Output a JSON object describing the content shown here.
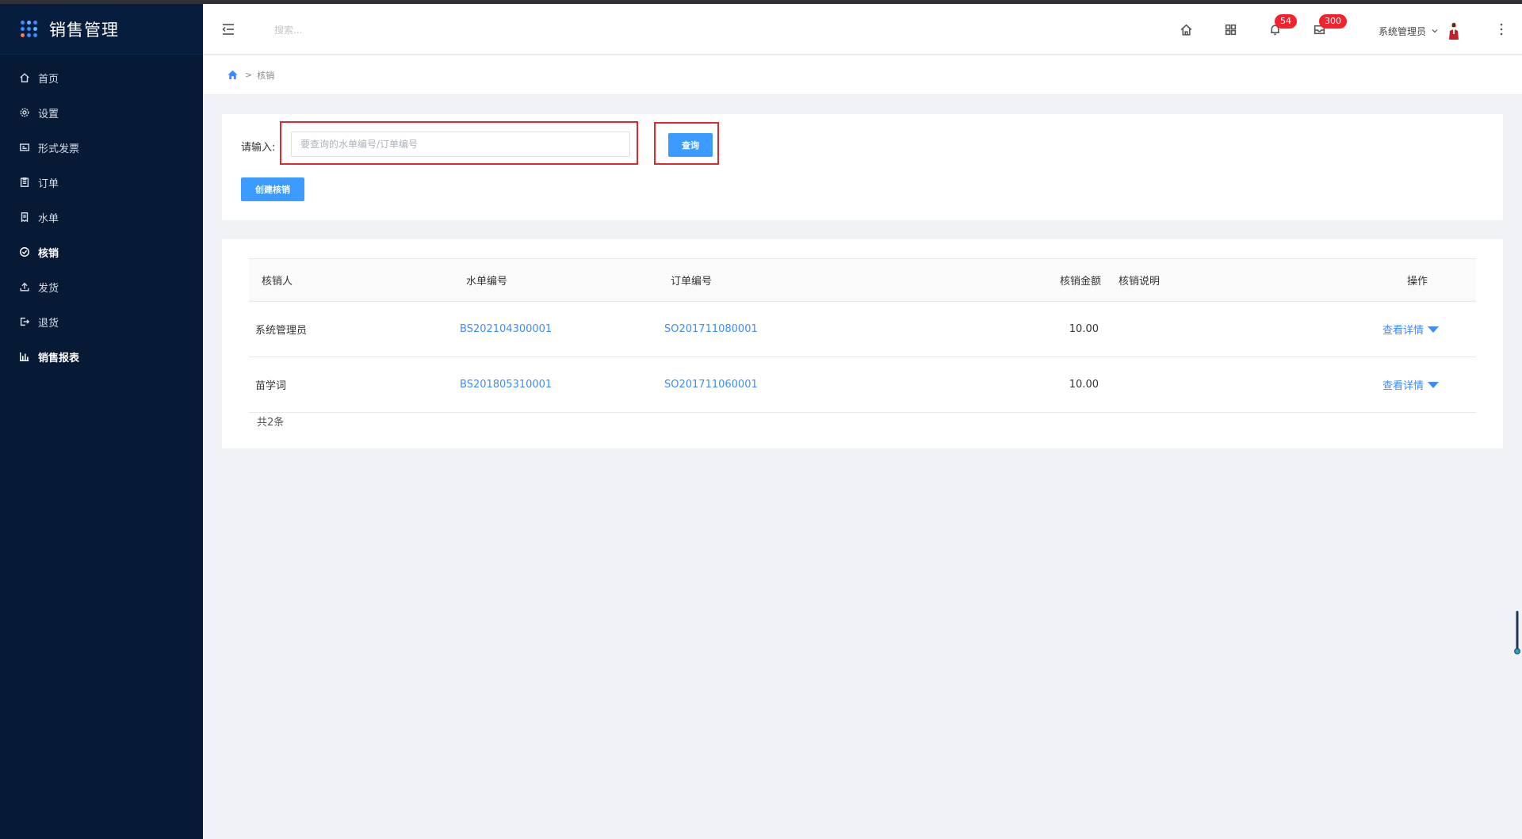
{
  "sidebar": {
    "brand": "销售管理",
    "items": [
      {
        "label": "首页",
        "icon": "home-icon"
      },
      {
        "label": "设置",
        "icon": "gear-icon"
      },
      {
        "label": "形式发票",
        "icon": "invoice-icon"
      },
      {
        "label": "订单",
        "icon": "clipboard-icon"
      },
      {
        "label": "水单",
        "icon": "receipt-icon"
      },
      {
        "label": "核销",
        "icon": "check-circle-icon"
      },
      {
        "label": "发货",
        "icon": "upload-icon"
      },
      {
        "label": "退货",
        "icon": "logout-icon"
      },
      {
        "label": "销售报表",
        "icon": "bar-chart-icon"
      }
    ],
    "active_index": 5
  },
  "header": {
    "search_placeholder": "搜索...",
    "notification_count": "54",
    "message_count": "300",
    "username": "系统管理员"
  },
  "breadcrumb": {
    "separator": ">",
    "current": "核销"
  },
  "query": {
    "label": "请输入:",
    "placeholder": "要查询的水单编号/订单编号",
    "search_button": "查询",
    "create_button": "创建核销"
  },
  "table": {
    "columns": [
      "核销人",
      "水单编号",
      "订单编号",
      "核销金额",
      "核销说明",
      "操作"
    ],
    "rows": [
      {
        "person": "系统管理员",
        "receipt_no": "BS202104300001",
        "order_no": "SO201711080001",
        "amount": "10.00",
        "note": "",
        "action": "查看详情"
      },
      {
        "person": "苗学词",
        "receipt_no": "BS201805310001",
        "order_no": "SO201711060001",
        "amount": "10.00",
        "note": "",
        "action": "查看详情"
      }
    ],
    "total": "共2条"
  },
  "colors": {
    "sidebar_bg": "#061a35",
    "primary": "#3c9bff",
    "link": "#3c8cff",
    "badge": "#f5222d",
    "highlight_box": "#e0282e"
  }
}
